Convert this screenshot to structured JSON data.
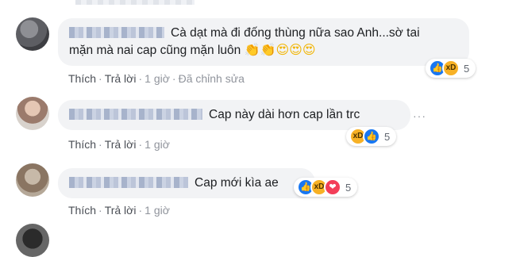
{
  "comments": [
    {
      "text_line1": "Cà dạt mà đi đống thùng nữa sao Anh...sờ tai",
      "text_line2": "mặn mà nai cap cũng mặn luôn",
      "emojis": [
        "👏",
        "👏",
        "😍",
        "😍",
        "😍"
      ],
      "actions": {
        "like": "Thích",
        "reply": "Trả lời",
        "time": "1 giờ",
        "edited": "Đã chỉnh sửa"
      },
      "reactions": {
        "types": [
          "like",
          "haha"
        ],
        "count": "5"
      }
    },
    {
      "text": "Cap này dài hơn cap lần trc",
      "more": "···",
      "actions": {
        "like": "Thích",
        "reply": "Trả lời",
        "time": "1 giờ"
      },
      "reactions": {
        "types": [
          "haha",
          "like"
        ],
        "count": "5"
      }
    },
    {
      "text": "Cap mới kìa ae",
      "actions": {
        "like": "Thích",
        "reply": "Trả lời",
        "time": "1 giờ"
      },
      "reactions": {
        "types": [
          "like",
          "haha",
          "love"
        ],
        "count": "5"
      }
    }
  ],
  "separator": "·",
  "colors": {
    "bubble": "#f2f3f5",
    "like": "#1877f2",
    "haha": "#f7b125",
    "love": "#f33e58",
    "meta": "#90949c"
  }
}
